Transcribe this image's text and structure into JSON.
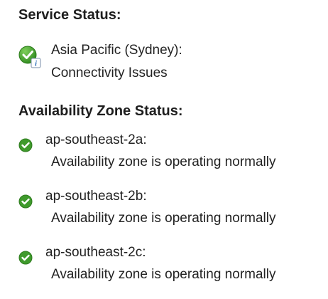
{
  "service": {
    "heading": "Service Status:",
    "region": "Asia Pacific (Sydney):",
    "status": "Connectivity Issues",
    "icon": "check-with-info-icon"
  },
  "availability": {
    "heading": "Availability Zone Status:",
    "zones": [
      {
        "name": "ap-southeast-2a:",
        "status": "Availability zone is operating normally",
        "icon": "check-circle-icon"
      },
      {
        "name": "ap-southeast-2b:",
        "status": "Availability zone is operating normally",
        "icon": "check-circle-icon"
      },
      {
        "name": "ap-southeast-2c:",
        "status": "Availability zone is operating normally",
        "icon": "check-circle-icon"
      }
    ]
  },
  "colors": {
    "check_green": "#3f9a2c",
    "info_blue": "#2f6fb8",
    "text": "#222222"
  }
}
